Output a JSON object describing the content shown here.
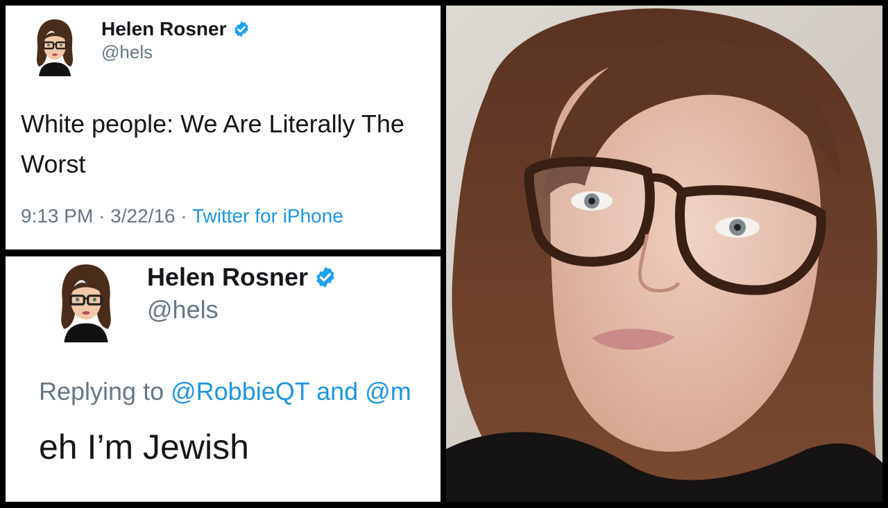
{
  "tweet1": {
    "name": "Helen Rosner",
    "handle": "@hels",
    "text": "White people: We Are Literally The Worst",
    "time": "9:13 PM",
    "date": "3/22/16",
    "source": "Twitter for iPhone",
    "separator": " · "
  },
  "tweet2": {
    "name": "Helen Rosner",
    "handle": "@hels",
    "replying_prefix": "Replying to ",
    "mention1": "@RobbieQT",
    "and_word": " and ",
    "mention2": "@m",
    "text": "eh I’m Jewish"
  },
  "colors": {
    "verified_blue": "#1da1f2",
    "link_blue": "#1b95e0",
    "secondary_text": "#657786",
    "primary_text": "#14171a"
  },
  "icons": {
    "verified": "verified-badge-icon",
    "avatar": "cartoon-avatar-icon"
  }
}
